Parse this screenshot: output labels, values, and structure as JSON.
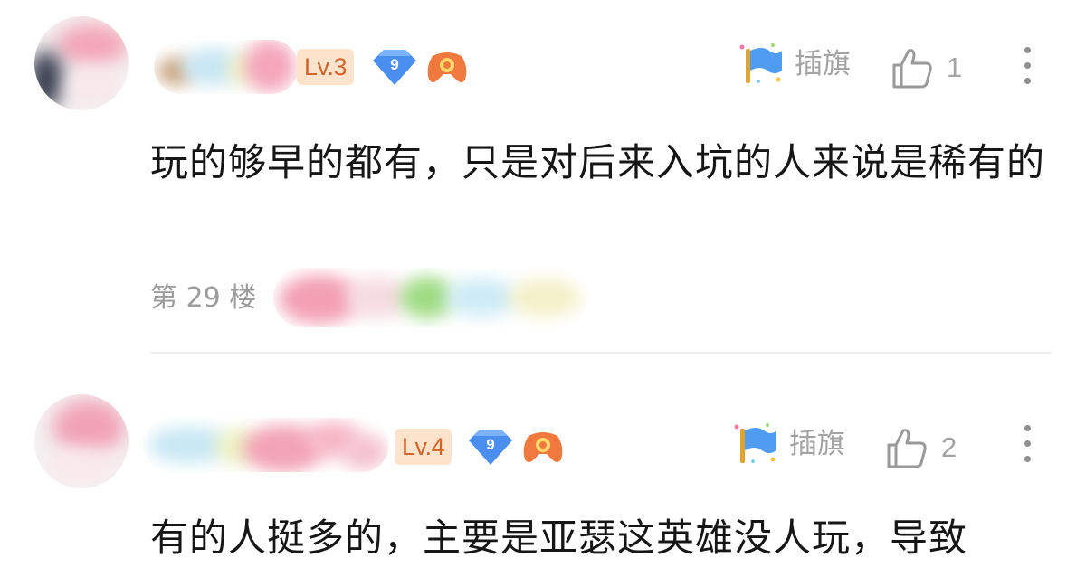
{
  "comments": [
    {
      "level": "Lv.3",
      "fan_badge_number": "9",
      "flag_label": "插旗",
      "like_count": "1",
      "text": "玩的够早的都有，只是对后来入坑的人来说是稀有的",
      "floor": "第 29 楼",
      "more_icon": "more-vertical-icon"
    },
    {
      "level": "Lv.4",
      "fan_badge_number": "9",
      "flag_label": "插旗",
      "like_count": "2",
      "text": "有的人挺多的，主要是亚瑟这英雄没人玩，导致",
      "more_icon": "more-vertical-icon"
    }
  ],
  "colors": {
    "level_badge_bg": "#fde2cc",
    "level_badge_text": "#d0652a",
    "gem_blue": "#4a8ff0",
    "flag_blue": "#4f9cf0",
    "secondary_text": "#a3a3a3"
  }
}
